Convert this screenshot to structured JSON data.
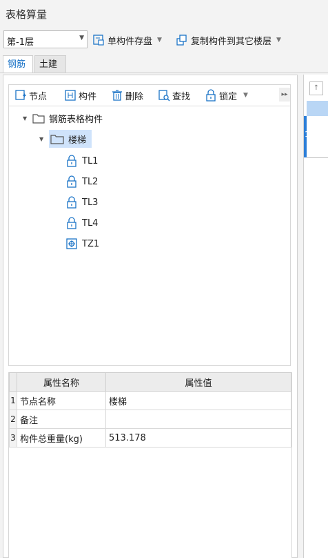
{
  "window": {
    "title": "表格算量"
  },
  "toolbar": {
    "floor_value": "第-1层",
    "save_component_label": "单构件存盘",
    "copy_to_floors_label": "复制构件到其它楼层"
  },
  "tabs": [
    {
      "label": "钢筋",
      "active": true
    },
    {
      "label": "土建",
      "active": false
    }
  ],
  "tree_toolbar": {
    "node_label": "节点",
    "component_label": "构件",
    "delete_label": "删除",
    "find_label": "查找",
    "lock_label": "锁定"
  },
  "tree": {
    "root": "钢筋表格构件",
    "group": "楼梯",
    "items": [
      {
        "label": "TL1",
        "icon": "lock-icon"
      },
      {
        "label": "TL2",
        "icon": "lock-icon"
      },
      {
        "label": "TL3",
        "icon": "lock-icon"
      },
      {
        "label": "TL4",
        "icon": "lock-icon"
      },
      {
        "label": "TZ1",
        "icon": "component-plus-icon"
      }
    ]
  },
  "properties": {
    "headers": [
      "属性名称",
      "属性值"
    ],
    "rows": [
      {
        "index": "1",
        "name": "节点名称",
        "value": "楼梯"
      },
      {
        "index": "2",
        "name": "备注",
        "value": ""
      },
      {
        "index": "3",
        "name": "构件总重量(kg)",
        "value": "513.178"
      }
    ]
  },
  "right_grid": {
    "row_number": "1"
  },
  "colors": {
    "accent": "#1a73c7",
    "selection": "#cfe3fb",
    "header_bg": "#ececec"
  }
}
